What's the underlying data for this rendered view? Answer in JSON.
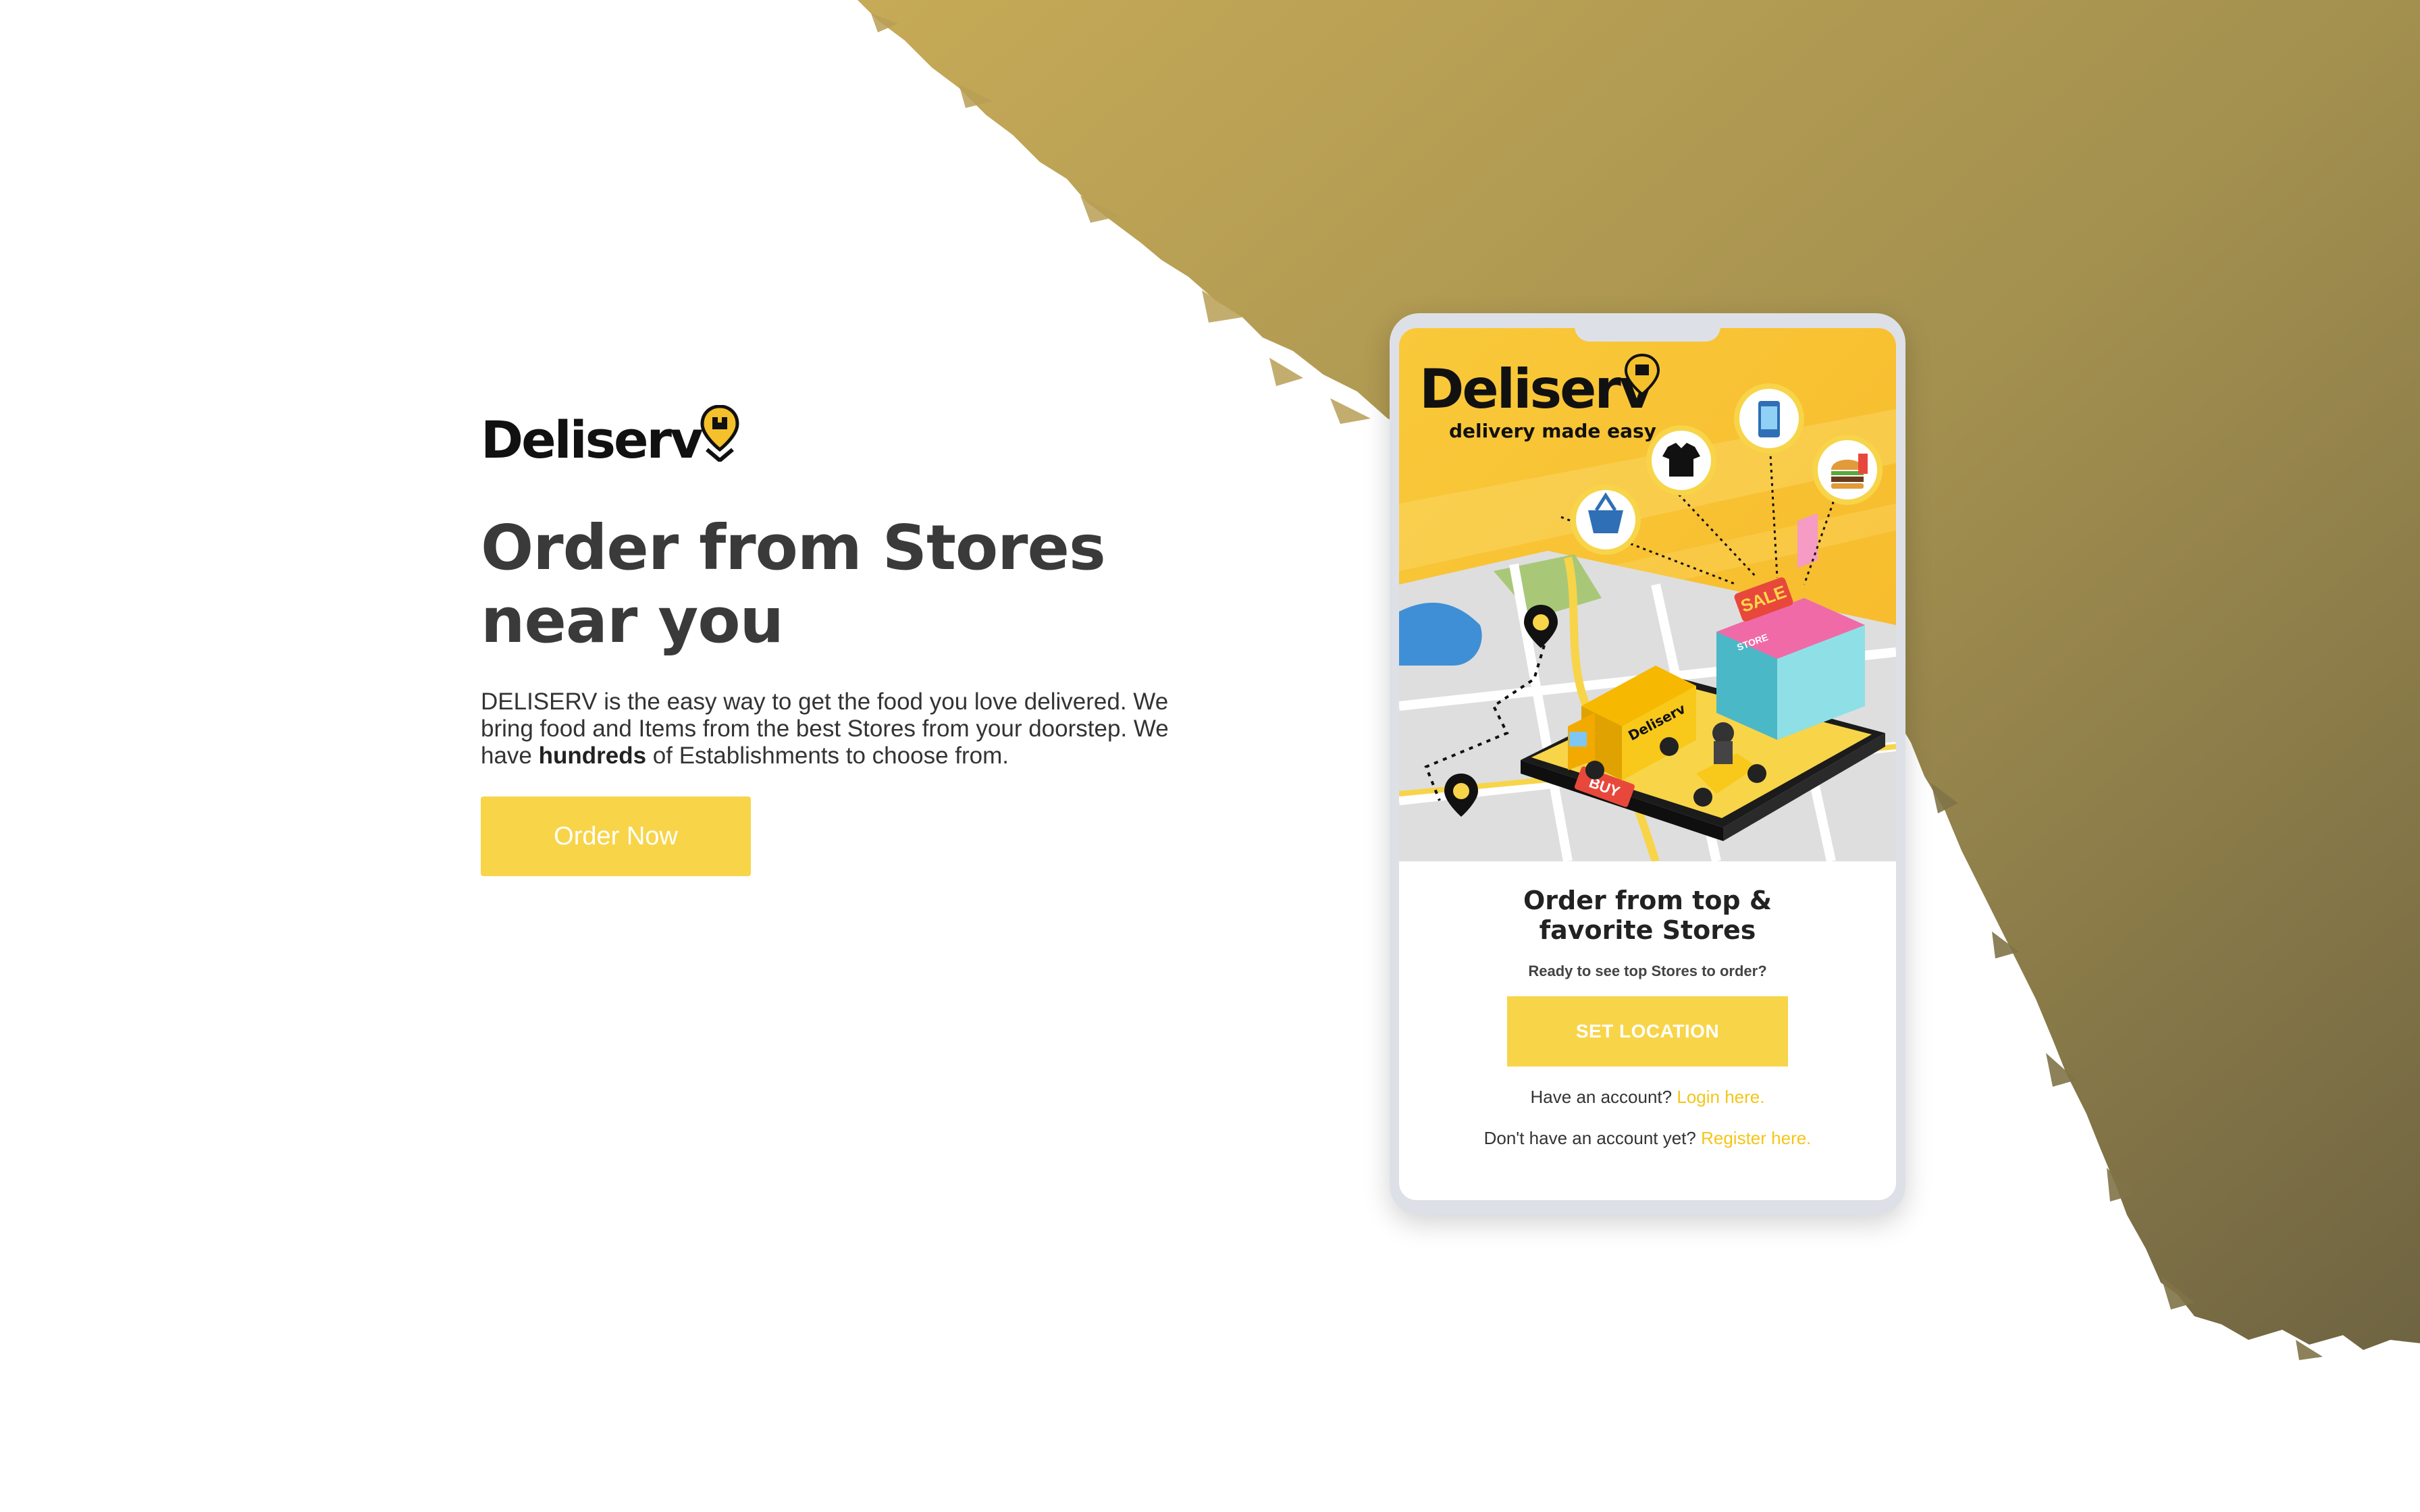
{
  "brand": {
    "name": "Deliserv",
    "tagline": "delivery made easy"
  },
  "hero": {
    "headline": "Order from Stores near you",
    "description_part1": "DELISERV is the easy way to get the food you love delivered. We bring food and Items from the best Stores from your doorstep. We have ",
    "description_bold": "hundreds",
    "description_part2": " of Establishments to choose from.",
    "cta_label": "Order Now"
  },
  "phone_card": {
    "badges": {
      "buy": "BUY",
      "sale": "SALE",
      "store": "STORE"
    },
    "title": "Order from top & favorite Stores",
    "subtitle": "Ready to see top Stores to order?",
    "button_label": "SET LOCATION",
    "login_prompt": "Have an account?",
    "login_link": "Login here.",
    "register_prompt": "Don't have an account yet?",
    "register_link": "Register here."
  },
  "colors": {
    "accent_yellow": "#f8d449",
    "gold_stroke_light": "#c1a655",
    "gold_stroke_dark": "#74683f",
    "heading_dark": "#3a3a3a"
  },
  "icons": [
    "location-pin-icon",
    "basket-icon",
    "tshirt-icon",
    "phone-icon",
    "burger-icon",
    "truck-icon",
    "scooter-icon"
  ]
}
